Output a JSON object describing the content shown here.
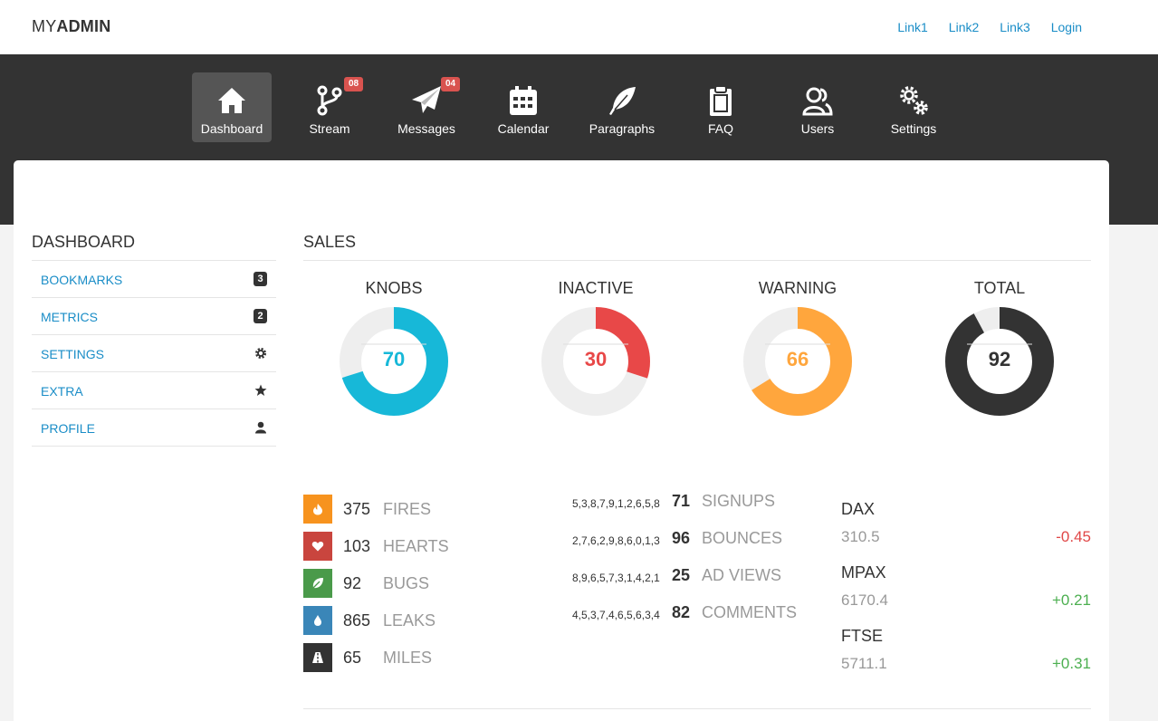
{
  "brand": {
    "prefix": "MY",
    "bold": "ADMIN"
  },
  "top_links": [
    "Link1",
    "Link2",
    "Link3",
    "Login"
  ],
  "nav": [
    {
      "label": "Dashboard",
      "icon": "home-icon",
      "active": true,
      "badge": ""
    },
    {
      "label": "Stream",
      "icon": "branch-icon",
      "active": false,
      "badge": "08"
    },
    {
      "label": "Messages",
      "icon": "paper-plane-icon",
      "active": false,
      "badge": "04"
    },
    {
      "label": "Calendar",
      "icon": "calendar-icon",
      "active": false,
      "badge": ""
    },
    {
      "label": "Paragraphs",
      "icon": "feather-icon",
      "active": false,
      "badge": ""
    },
    {
      "label": "FAQ",
      "icon": "clipboard-icon",
      "active": false,
      "badge": ""
    },
    {
      "label": "Users",
      "icon": "users-icon",
      "active": false,
      "badge": ""
    },
    {
      "label": "Settings",
      "icon": "gears-icon",
      "active": false,
      "badge": ""
    }
  ],
  "sidebar": {
    "title": "DASHBOARD",
    "items": [
      {
        "label": "BOOKMARKS",
        "badge": "3",
        "icon": ""
      },
      {
        "label": "METRICS",
        "badge": "2",
        "icon": ""
      },
      {
        "label": "SETTINGS",
        "badge": "",
        "icon": "gear-icon"
      },
      {
        "label": "EXTRA",
        "badge": "",
        "icon": "star-icon"
      },
      {
        "label": "PROFILE",
        "badge": "",
        "icon": "user-icon"
      }
    ]
  },
  "sales": {
    "title": "SALES",
    "donuts": [
      {
        "label": "KNOBS",
        "value": "70",
        "percent": 70,
        "color": "#17b8d8"
      },
      {
        "label": "INACTIVE",
        "value": "30",
        "percent": 30,
        "color": "#e84848"
      },
      {
        "label": "WARNING",
        "value": "66",
        "percent": 66,
        "color": "#ffa63d"
      },
      {
        "label": "TOTAL",
        "value": "92",
        "percent": 92,
        "color": "#333333"
      }
    ]
  },
  "stats": [
    {
      "value": "375",
      "label": "FIRES",
      "icon": "fire-icon",
      "color": "#f7931e"
    },
    {
      "value": "103",
      "label": "HEARTS",
      "icon": "heart-icon",
      "color": "#c9453e"
    },
    {
      "value": "92",
      "label": "BUGS",
      "icon": "leaf-icon",
      "color": "#4a9a4a"
    },
    {
      "value": "865",
      "label": "LEAKS",
      "icon": "drop-icon",
      "color": "#3a86b8"
    },
    {
      "value": "65",
      "label": "MILES",
      "icon": "road-icon",
      "color": "#333333"
    }
  ],
  "sparks": [
    {
      "sequence": "5,3,8,7,9,1,2,6,5,8",
      "value": "71",
      "label": "SIGNUPS"
    },
    {
      "sequence": "2,7,6,2,9,8,6,0,1,3",
      "value": "96",
      "label": "BOUNCES"
    },
    {
      "sequence": "8,9,6,5,7,3,1,4,2,1",
      "value": "25",
      "label": "AD VIEWS"
    },
    {
      "sequence": "4,5,3,7,4,6,5,6,3,4",
      "value": "82",
      "label": "COMMENTS"
    }
  ],
  "tickers": [
    {
      "name": "DAX",
      "value": "310.5",
      "change": "-0.45",
      "direction": "down"
    },
    {
      "name": "MPAX",
      "value": "6170.4",
      "change": "+0.21",
      "direction": "up"
    },
    {
      "name": "FTSE",
      "value": "5711.1",
      "change": "+0.31",
      "direction": "up"
    }
  ]
}
